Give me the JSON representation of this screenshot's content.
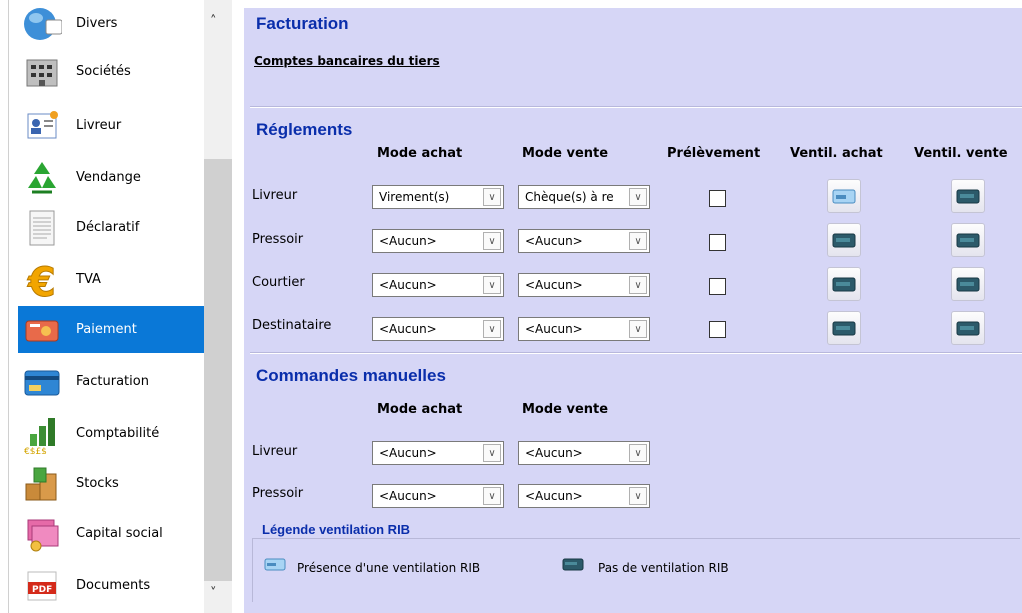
{
  "sidebar": {
    "items": [
      {
        "label": "Divers",
        "icon": "globe-icon",
        "active": false
      },
      {
        "label": "Sociétés",
        "icon": "building-icon",
        "active": false
      },
      {
        "label": "Livreur",
        "icon": "person-card-icon",
        "active": false
      },
      {
        "label": "Vendange",
        "icon": "recycle-icon",
        "active": false
      },
      {
        "label": "Déclaratif",
        "icon": "document-icon",
        "active": false
      },
      {
        "label": "TVA",
        "icon": "euro-icon",
        "active": false
      },
      {
        "label": "Paiement",
        "icon": "credit-card-icon",
        "active": true
      },
      {
        "label": "Facturation",
        "icon": "billing-card-icon",
        "active": false
      },
      {
        "label": "Comptabilité",
        "icon": "chart-coins-icon",
        "active": false
      },
      {
        "label": "Stocks",
        "icon": "boxes-icon",
        "active": false
      },
      {
        "label": "Capital social",
        "icon": "money-icon",
        "active": false
      },
      {
        "label": "Documents",
        "icon": "pdf-icon",
        "active": false
      }
    ]
  },
  "facturation": {
    "title": "Facturation",
    "link": "Comptes bancaires du tiers"
  },
  "reglements": {
    "title": "Réglements",
    "headers": {
      "mode_achat": "Mode achat",
      "mode_vente": "Mode vente",
      "prelevement": "Prélèvement",
      "ventil_achat": "Ventil. achat",
      "ventil_vente": "Ventil. vente"
    },
    "rows": [
      {
        "label": "Livreur",
        "mode_achat": "Virement(s)",
        "mode_vente": "Chèque(s) à re",
        "prelevement": false,
        "ventil_achat": "presence",
        "ventil_vente": "absence"
      },
      {
        "label": "Pressoir",
        "mode_achat": "<Aucun>",
        "mode_vente": "<Aucun>",
        "prelevement": false,
        "ventil_achat": "absence",
        "ventil_vente": "absence"
      },
      {
        "label": "Courtier",
        "mode_achat": "<Aucun>",
        "mode_vente": "<Aucun>",
        "prelevement": false,
        "ventil_achat": "absence",
        "ventil_vente": "absence"
      },
      {
        "label": "Destinataire",
        "mode_achat": "<Aucun>",
        "mode_vente": "<Aucun>",
        "prelevement": false,
        "ventil_achat": "absence",
        "ventil_vente": "absence"
      }
    ]
  },
  "commandes": {
    "title": "Commandes manuelles",
    "headers": {
      "mode_achat": "Mode achat",
      "mode_vente": "Mode vente"
    },
    "rows": [
      {
        "label": "Livreur",
        "mode_achat": "<Aucun>",
        "mode_vente": "<Aucun>"
      },
      {
        "label": "Pressoir",
        "mode_achat": "<Aucun>",
        "mode_vente": "<Aucun>"
      }
    ]
  },
  "legende": {
    "title": "Légende ventilation RIB",
    "presence": "Présence d'une ventilation RIB",
    "absence": "Pas de ventilation RIB"
  },
  "colors": {
    "panel_bg": "#d6d6f6",
    "title_blue": "#0a2eab",
    "active_bg": "#0a78d7"
  }
}
